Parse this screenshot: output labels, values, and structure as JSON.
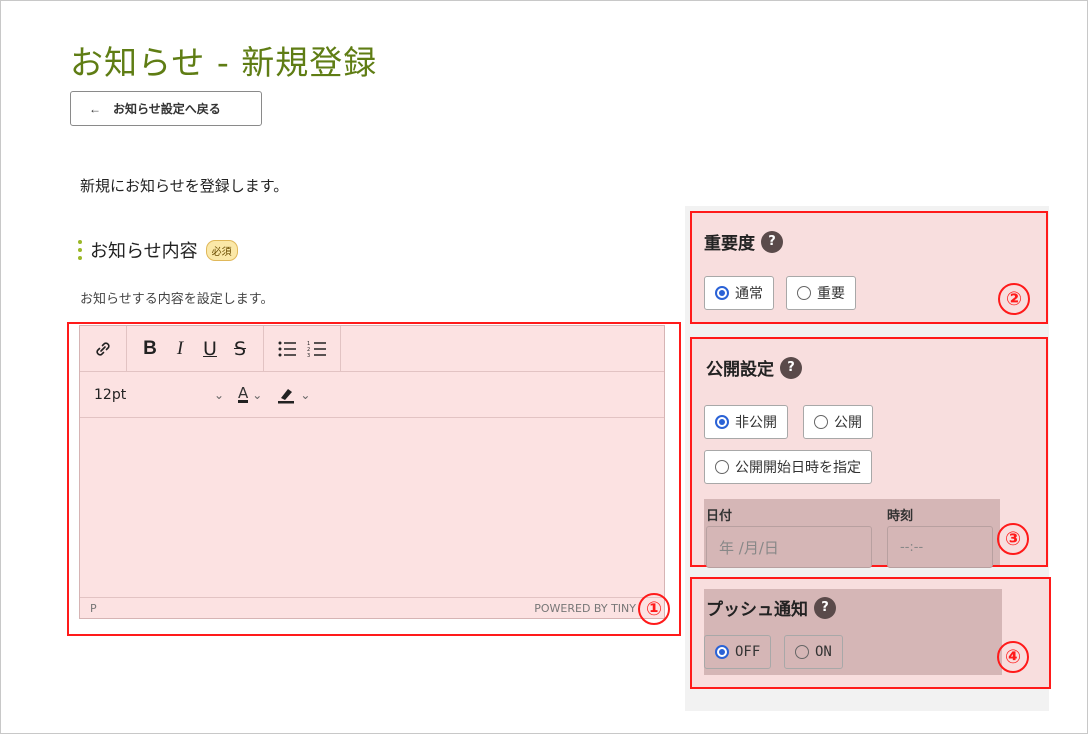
{
  "page": {
    "title": "お知らせ - 新規登録",
    "back_label": "お知らせ設定へ戻る",
    "back_arrow": "←",
    "description": "新規にお知らせを登録します。"
  },
  "content_section": {
    "title": "お知らせ内容",
    "required_badge": "必須",
    "subtitle": "お知らせする内容を設定します。"
  },
  "editor": {
    "toolbar": {
      "link_icon": "link-icon",
      "bold": "B",
      "italic": "I",
      "underline": "U",
      "strikethrough": "S",
      "bullet_list_icon": "bullet-list-icon",
      "numbered_list_icon": "numbered-list-icon",
      "font_size": "12pt",
      "font_color_letter": "A"
    },
    "status_path": "P",
    "powered_by": "POWERED BY TINY"
  },
  "importance": {
    "title": "重要度",
    "options": [
      "通常",
      "重要"
    ],
    "selected": "通常"
  },
  "publish": {
    "title": "公開設定",
    "options": [
      "非公開",
      "公開",
      "公開開始日時を指定"
    ],
    "selected": "非公開",
    "date_label": "日付",
    "time_label": "時刻",
    "date_placeholder": "年 /月/日",
    "time_placeholder": "--:--"
  },
  "push": {
    "title": "プッシュ通知",
    "options": [
      "OFF",
      "ON"
    ],
    "selected": "OFF"
  },
  "callouts": [
    "①",
    "②",
    "③",
    "④"
  ],
  "help_mark": "?",
  "colors": {
    "title_green": "#5f7d14",
    "highlight_red": "#ff1a1a",
    "radio_blue": "#2a62d6"
  }
}
